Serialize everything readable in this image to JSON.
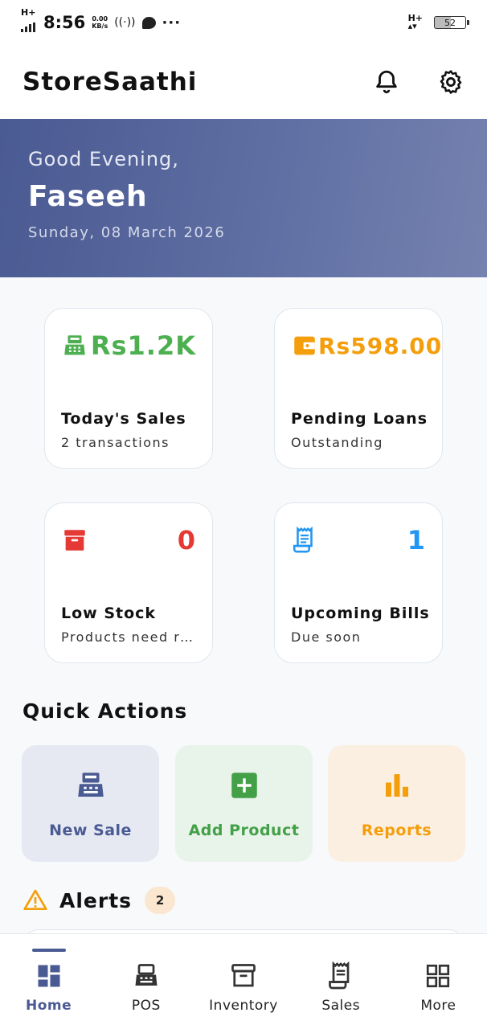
{
  "status_bar": {
    "network": "H+",
    "time": "8:56",
    "speed_value": "0.00",
    "speed_unit": "KB/s",
    "network_right": "H+",
    "battery": "52"
  },
  "app_bar": {
    "title": "StoreSaathi",
    "notifications_icon": "bell-icon",
    "settings_icon": "gear-icon"
  },
  "hero": {
    "greeting": "Good Evening,",
    "name": "Faseeh",
    "date": "Sunday, 08 March 2026",
    "gradient_start": "#4a5a92",
    "gradient_end": "#7582b0"
  },
  "stats": [
    {
      "icon": "cash-register-icon",
      "value": "Rs1.2K",
      "title": "Today's Sales",
      "subtitle": "2 transactions",
      "color": "#4caf50"
    },
    {
      "icon": "wallet-icon",
      "value": "Rs598.00",
      "title": "Pending Loans",
      "subtitle": "Outstanding",
      "color": "#f59e0b"
    },
    {
      "icon": "archive-box-icon",
      "value": "0",
      "title": "Low Stock",
      "subtitle": "Products need re...",
      "color": "#e53935"
    },
    {
      "icon": "receipt-icon",
      "value": "1",
      "title": "Upcoming Bills",
      "subtitle": "Due soon",
      "color": "#2196f3"
    }
  ],
  "quick_actions": {
    "title": "Quick Actions",
    "items": [
      {
        "label": "New Sale",
        "icon": "cash-register-icon",
        "color": "#4a5a92",
        "bg": "#e6e9f2"
      },
      {
        "label": "Add Product",
        "icon": "add-box-icon",
        "color": "#43a047",
        "bg": "#e8f3ea"
      },
      {
        "label": "Reports",
        "icon": "bar-chart-icon",
        "color": "#f59e0b",
        "bg": "#fbefe1"
      }
    ]
  },
  "alerts": {
    "title": "Alerts",
    "count": "2",
    "icon": "warning-icon"
  },
  "bottom_nav": {
    "items": [
      {
        "label": "Home",
        "icon": "dashboard-icon",
        "active": true
      },
      {
        "label": "POS",
        "icon": "cash-register-icon",
        "active": false
      },
      {
        "label": "Inventory",
        "icon": "archive-box-icon",
        "active": false
      },
      {
        "label": "Sales",
        "icon": "receipt-icon",
        "active": false
      },
      {
        "label": "More",
        "icon": "grid-icon",
        "active": false
      }
    ],
    "active_color": "#4a5a92"
  }
}
